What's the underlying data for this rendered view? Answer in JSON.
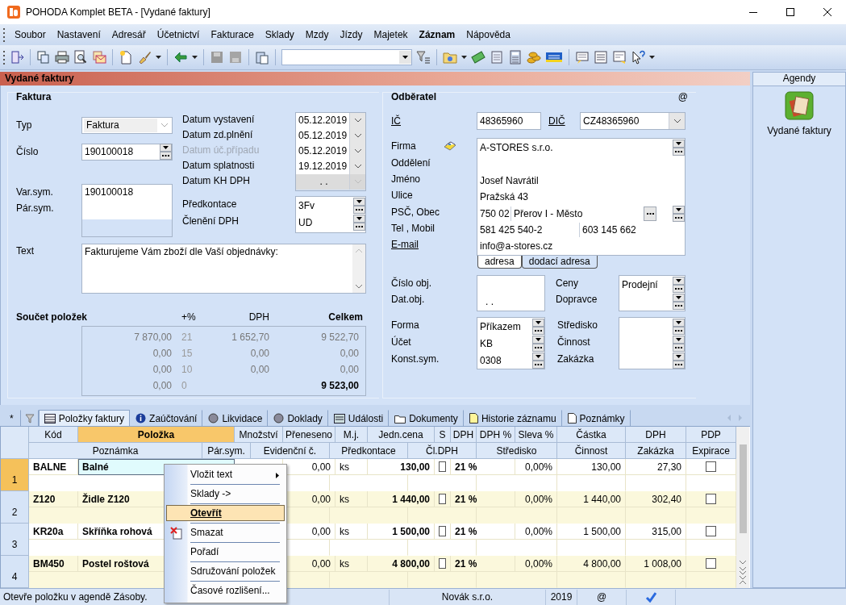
{
  "window": {
    "title": "POHODA Komplet BETA - [Vydané faktury]"
  },
  "menu": [
    {
      "label": "Soubor",
      "bold": false
    },
    {
      "label": "Nastavení",
      "bold": false
    },
    {
      "label": "Adresář",
      "bold": false
    },
    {
      "label": "Účetnictví",
      "bold": false
    },
    {
      "label": "Fakturace",
      "bold": false
    },
    {
      "label": "Sklady",
      "bold": false
    },
    {
      "label": "Mzdy",
      "bold": false
    },
    {
      "label": "Jízdy",
      "bold": false
    },
    {
      "label": "Majetek",
      "bold": false
    },
    {
      "label": "Záznam",
      "bold": true
    },
    {
      "label": "Nápověda",
      "bold": false
    }
  ],
  "panel": {
    "title": "Vydané faktury"
  },
  "invoice": {
    "title": "Faktura",
    "type": {
      "label": "Typ",
      "value": "Faktura"
    },
    "number": {
      "label": "Číslo",
      "value": "190100018"
    },
    "symbols": {
      "labels": [
        "Var.sym.",
        "Pár.sym."
      ],
      "value": "190100018"
    },
    "dates": [
      {
        "label": "Datum vystavení",
        "value": "05.12.2019",
        "disabled": false,
        "locked": false
      },
      {
        "label": "Datum zd.plnění",
        "value": "05.12.2019",
        "disabled": false,
        "locked": false
      },
      {
        "label": "Datum úč.případu",
        "value": "05.12.2019",
        "disabled": true,
        "locked": false
      },
      {
        "label": "Datum splatnosti",
        "value": "19.12.2019",
        "disabled": false,
        "locked": false
      },
      {
        "label": "Datum KH DPH",
        "value": ". .",
        "disabled": false,
        "locked": true
      }
    ],
    "accounting": [
      {
        "label": "Předkontace",
        "value": "3Fv"
      },
      {
        "label": "Členění DPH",
        "value": "UD"
      }
    ],
    "text": {
      "label": "Text",
      "value": "Fakturujeme Vám zboží dle Vaší objednávky:"
    },
    "totals": {
      "title": "Součet položek",
      "columns": [
        "+%",
        "DPH",
        "Celkem"
      ],
      "rows": [
        {
          "base": "7 870,00",
          "rate": "21",
          "vat": "1 652,70",
          "total": "9 522,70",
          "bold": false
        },
        {
          "base": "0,00",
          "rate": "15",
          "vat": "0,00",
          "total": "0,00",
          "bold": false
        },
        {
          "base": "0,00",
          "rate": "10",
          "vat": "0,00",
          "total": "0,00",
          "bold": false
        },
        {
          "base": "0,00",
          "rate": "0",
          "total": "9 523,00",
          "bold": true
        }
      ]
    }
  },
  "customer": {
    "title": "Odběratel",
    "at": "@",
    "ico": {
      "label": "IČ",
      "value": "48365960"
    },
    "dic": {
      "label": "DIČ",
      "value": "CZ48365960"
    },
    "address": [
      {
        "label": "Firma",
        "kind": "company",
        "value": "A-STORES s.r.o.",
        "link": false
      },
      {
        "label": "Oddělení",
        "kind": "text",
        "link": false
      },
      {
        "label": "Jméno",
        "kind": "text",
        "value": "Josef Navrátil",
        "link": false
      },
      {
        "label": "Ulice",
        "kind": "text",
        "value": "Pražská 43",
        "link": false
      },
      {
        "label": "PSČ, Obec",
        "kind": "city",
        "value": "750 02",
        "value2": "Přerov I - Město",
        "link": false
      },
      {
        "label": "Tel , Mobil",
        "kind": "phone",
        "value": "581 425 540-2",
        "value2": "603 145 662",
        "link": false
      },
      {
        "label": "E-mail",
        "kind": "text",
        "value": "info@a-stores.cz",
        "link": true
      }
    ],
    "address_tabs": [
      {
        "label": "adresa",
        "selected": true
      },
      {
        "label": "dodací adresa",
        "selected": false
      }
    ],
    "order": [
      {
        "label": "Číslo obj."
      },
      {
        "label": "Dat.obj.",
        "value": ". ."
      }
    ],
    "prices": [
      {
        "label": "Ceny",
        "value": "Prodejní"
      },
      {
        "label": "Dopravce"
      }
    ],
    "payment": [
      {
        "label": "Forma",
        "value": "Příkazem"
      },
      {
        "label": "Účet",
        "value": "KB"
      },
      {
        "label": "Konst.sym.",
        "value": "0308"
      }
    ],
    "center": [
      {
        "label": "Středisko"
      },
      {
        "label": "Činnost"
      },
      {
        "label": "Zakázka"
      }
    ]
  },
  "agendas": {
    "title": "Agendy",
    "items": [
      {
        "label": "Vydané faktury"
      }
    ]
  },
  "tabs": {
    "star": "*",
    "items": [
      {
        "label": "Položky faktury",
        "selected": true
      },
      {
        "label": "Zaúčtování",
        "selected": false
      },
      {
        "label": "Likvidace",
        "selected": false
      },
      {
        "label": "Doklady",
        "selected": false
      },
      {
        "label": "Události",
        "selected": false
      },
      {
        "label": "Dokumenty",
        "selected": false
      },
      {
        "label": "Historie záznamu",
        "selected": false
      },
      {
        "label": "Poznámky",
        "selected": false
      }
    ]
  },
  "table": {
    "columns": [
      {
        "label": "Kód",
        "selected": false
      },
      {
        "label": "Položka",
        "selected": true
      },
      {
        "label": "Množství",
        "selected": false
      },
      {
        "label": "Přeneseno",
        "selected": false
      },
      {
        "label": "M.j.",
        "selected": false
      },
      {
        "label": "Jedn.cena",
        "selected": false
      },
      {
        "label": "S",
        "selected": false
      },
      {
        "label": "DPH",
        "selected": false
      },
      {
        "label": "DPH %",
        "selected": false
      },
      {
        "label": "Sleva %",
        "selected": false
      },
      {
        "label": "Částka",
        "selected": false
      },
      {
        "label": "DPH",
        "selected": false
      },
      {
        "label": "PDP",
        "selected": false
      }
    ],
    "columns2": [
      "Poznámka",
      "Pár.sym.",
      "Evidenční č.",
      "Předkontace",
      "Čl.DPH",
      "Středisko",
      "Činnost",
      "Zakázka",
      "Expirace"
    ],
    "rows": [
      {
        "num": "1",
        "selected": true,
        "code": "BALNE",
        "name": "Balné",
        "transferred": "0,00",
        "unit": "ks",
        "price": "130,00",
        "s": false,
        "vat": "21 %",
        "discount": "0,00%",
        "amount": "130,00",
        "vat_amount": "27,30",
        "pdp": false
      },
      {
        "num": "2",
        "selected": false,
        "code": "Z120",
        "name": "Židle Z120",
        "transferred": "0,00",
        "unit": "ks",
        "price": "1 440,00",
        "s": false,
        "vat": "21 %",
        "discount": "0,00%",
        "amount": "1 440,00",
        "vat_amount": "302,40",
        "pdp": false
      },
      {
        "num": "3",
        "selected": false,
        "code": "KR20a",
        "name": "Skříňka rohová",
        "transferred": "0,00",
        "unit": "ks",
        "price": "1 500,00",
        "s": false,
        "vat": "21 %",
        "discount": "0,00%",
        "amount": "1 500,00",
        "vat_amount": "315,00",
        "pdp": false
      },
      {
        "num": "4",
        "selected": false,
        "code": "BM450",
        "name": "Postel roštová",
        "transferred": "0,00",
        "unit": "ks",
        "price": "4 800,00",
        "s": false,
        "vat": "21 %",
        "discount": "0,00%",
        "amount": "4 800,00",
        "vat_amount": "1 008,00",
        "pdp": false
      }
    ]
  },
  "context_menu": [
    {
      "label": "Vložit text",
      "submenu": true,
      "highlighted": false,
      "kind": "plain"
    },
    {
      "label": "Sklady ->",
      "submenu": false,
      "highlighted": false,
      "kind": "plain"
    },
    {
      "label": "Otevřít",
      "submenu": false,
      "highlighted": true,
      "kind": "plain"
    },
    {
      "label": "Smazat",
      "submenu": false,
      "highlighted": false,
      "kind": "delete"
    },
    {
      "label": "Pořadí",
      "submenu": false,
      "highlighted": false,
      "kind": "plain"
    },
    {
      "label": "Sdružování položek",
      "submenu": false,
      "highlighted": false,
      "kind": "plain"
    },
    {
      "label": "Časové rozlišení...",
      "submenu": false,
      "highlighted": false,
      "kind": "plain"
    }
  ],
  "status_bar": {
    "message": "Otevře položku v agendě Zásoby.",
    "company": "Novák s.r.o.",
    "year": "2019",
    "at": "@"
  }
}
